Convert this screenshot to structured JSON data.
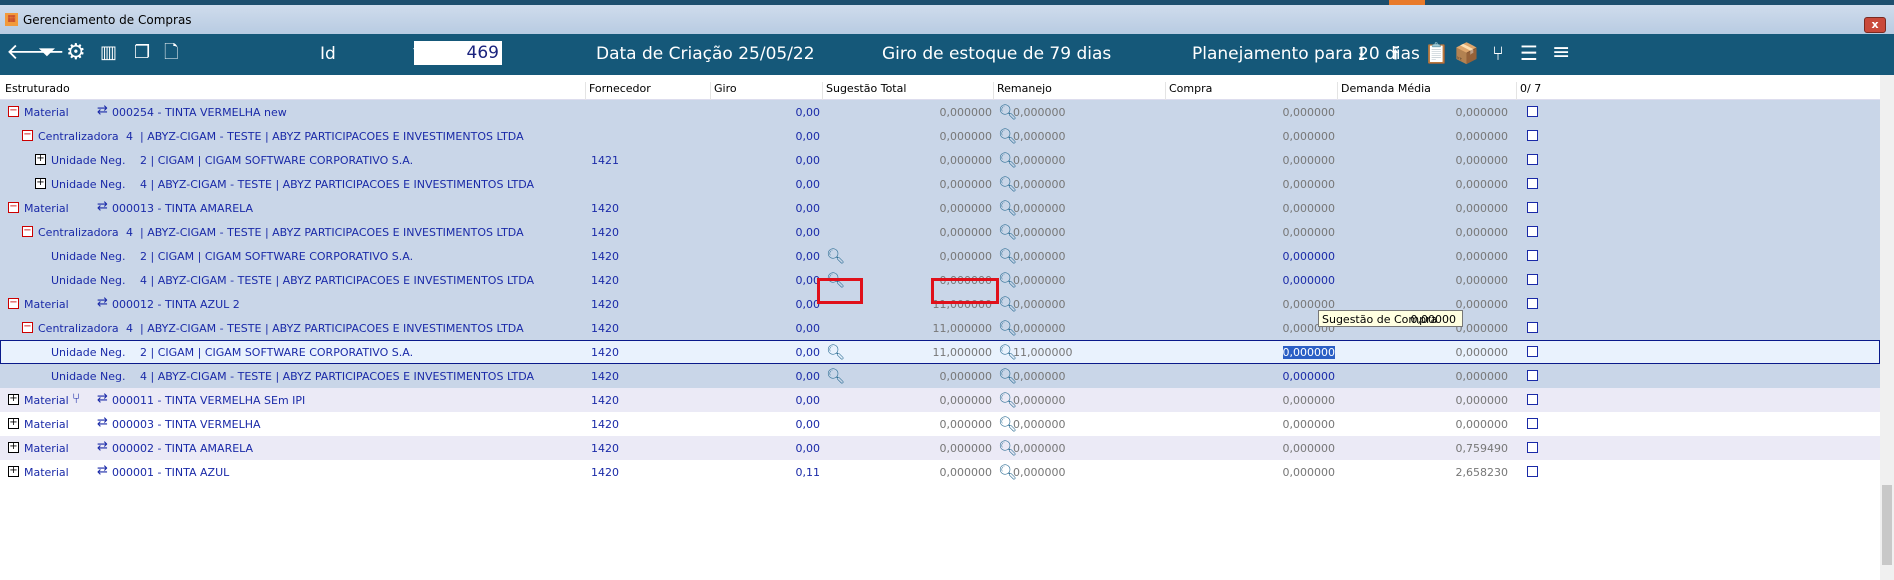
{
  "window": {
    "title": "Gerenciamento de Compras",
    "close": "x"
  },
  "toolbar": {
    "id_label": "Id",
    "id_value": "469",
    "data_criacao": "Data de Criação 25/05/22",
    "giro": "Giro de estoque de  79 dias",
    "planejamento": "Planejamento para 20 dias",
    "icons_left": [
      "arrow-left-icon",
      "filter-icon",
      "gear-icon",
      "bar-chart-icon",
      "copy-icon",
      "new-document-icon"
    ],
    "icons_right": [
      "download-icon",
      "upload-icon",
      "clipboard-icon",
      "box-icon",
      "merge-icon",
      "checklist-icon",
      "menu-icon"
    ]
  },
  "columns": [
    "Estruturado",
    "Fornecedor",
    "Giro",
    "Sugestão Total",
    "Remanejo",
    "Compra",
    "Demanda Média",
    "0/  7"
  ],
  "rows": [
    {
      "lvl": 0,
      "exp": "minus",
      "type": "Material",
      "code": "000254 - TINTA VERMELHA new",
      "forn": "",
      "giro": "0,00",
      "sug": "0,000000",
      "rem": "0,000000",
      "compra": "0,000000",
      "dem": "0,000000",
      "bg": "blue"
    },
    {
      "lvl": 1,
      "exp": "minus",
      "type": "Centralizadora",
      "num": "4",
      "code": "| ABYZ-CIGAM - TESTE | ABYZ PARTICIPACOES E INVESTIMENTOS LTDA",
      "forn": "",
      "giro": "0,00",
      "sug": "0,000000",
      "rem": "0,000000",
      "compra": "0,000000",
      "dem": "0,000000",
      "bg": "blue"
    },
    {
      "lvl": 2,
      "exp": "plus",
      "type": "Unidade Neg.",
      "code": "2 | CIGAM | CIGAM SOFTWARE CORPORATIVO S.A.",
      "forn": "1421",
      "giro": "0,00",
      "sug": "0,000000",
      "rem": "0,000000",
      "compra": "0,000000",
      "dem": "0,000000",
      "bg": "blue"
    },
    {
      "lvl": 2,
      "exp": "plus",
      "type": "Unidade Neg.",
      "code": "4 | ABYZ-CIGAM - TESTE | ABYZ PARTICIPACOES E INVESTIMENTOS LTDA",
      "forn": "",
      "giro": "0,00",
      "sug": "0,000000",
      "rem": "0,000000",
      "compra": "0,000000",
      "dem": "0,000000",
      "bg": "blue"
    },
    {
      "lvl": 0,
      "exp": "minus",
      "type": "Material",
      "code": "000013 - TINTA AMARELA",
      "forn": "1420",
      "giro": "0,00",
      "sug": "0,000000",
      "rem": "0,000000",
      "compra": "0,000000",
      "dem": "0,000000",
      "bg": "blue"
    },
    {
      "lvl": 1,
      "exp": "minus",
      "type": "Centralizadora",
      "num": "4",
      "code": "| ABYZ-CIGAM - TESTE | ABYZ PARTICIPACOES E INVESTIMENTOS LTDA",
      "forn": "1420",
      "giro": "0,00",
      "sug": "0,000000",
      "rem": "0,000000",
      "compra": "0,000000",
      "dem": "0,000000",
      "bg": "blue"
    },
    {
      "lvl": 2,
      "exp": "",
      "type": "Unidade Neg.",
      "code": "2 | CIGAM | CIGAM SOFTWARE CORPORATIVO S.A.",
      "forn": "1420",
      "giro": "0,00",
      "giromag": true,
      "sug": "0,000000",
      "rem": "0,000000",
      "compra": "0,000000",
      "compraBlue": true,
      "dem": "0,000000",
      "bg": "blue"
    },
    {
      "lvl": 2,
      "exp": "",
      "type": "Unidade Neg.",
      "code": "4 | ABYZ-CIGAM - TESTE | ABYZ PARTICIPACOES E INVESTIMENTOS LTDA",
      "forn": "1420",
      "giro": "0,00",
      "giromag": true,
      "sug": "0,000000",
      "rem": "0,000000",
      "compra": "0,000000",
      "compraBlue": true,
      "dem": "0,000000",
      "bg": "blue"
    },
    {
      "lvl": 0,
      "exp": "minus",
      "type": "Material",
      "code": "000012 - TINTA AZUL 2",
      "forn": "1420",
      "giro": "0,00",
      "sug": "11,000000",
      "rem": "0,000000",
      "compra": "0,000000",
      "dem": "0,000000",
      "bg": "blue"
    },
    {
      "lvl": 1,
      "exp": "minus",
      "type": "Centralizadora",
      "num": "4",
      "code": "| ABYZ-CIGAM - TESTE | ABYZ PARTICIPACOES E INVESTIMENTOS LTDA",
      "forn": "1420",
      "giro": "0,00",
      "sug": "11,000000",
      "rem": "0,000000",
      "compra": "0,000000",
      "dem": "0,000000",
      "bg": "blue"
    },
    {
      "lvl": 2,
      "exp": "",
      "type": "Unidade Neg.",
      "code": "2 | CIGAM | CIGAM SOFTWARE CORPORATIVO S.A.",
      "forn": "1420",
      "giro": "0,00",
      "giromag": true,
      "sug": "11,000000",
      "rem": "11,000000",
      "compra": "0,000000",
      "compraHl": true,
      "dem": "0,000000",
      "bg": "sel"
    },
    {
      "lvl": 2,
      "exp": "",
      "type": "Unidade Neg.",
      "code": "4 | ABYZ-CIGAM - TESTE | ABYZ PARTICIPACOES E INVESTIMENTOS LTDA",
      "forn": "1420",
      "giro": "0,00",
      "giromag": true,
      "sug": "0,000000",
      "rem": "0,000000",
      "compra": "0,000000",
      "compraBlue": true,
      "dem": "0,000000",
      "bg": "blue"
    },
    {
      "lvl": 0,
      "exp": "plus",
      "type": "Material",
      "merge": true,
      "code": "000011 - TINTA VERMELHA SEm IPI",
      "forn": "1420",
      "giro": "0,00",
      "sug": "0,000000",
      "rem": "0,000000",
      "compra": "0,000000",
      "dem": "0,000000",
      "bg": "lav"
    },
    {
      "lvl": 0,
      "exp": "plus",
      "type": "Material",
      "code": "000003 - TINTA VERMELHA",
      "forn": "1420",
      "giro": "0,00",
      "sug": "0,000000",
      "rem": "0,000000",
      "compra": "0,000000",
      "dem": "0,000000",
      "bg": "white"
    },
    {
      "lvl": 0,
      "exp": "plus",
      "type": "Material",
      "code": "000002 - TINTA AMARELA",
      "forn": "1420",
      "giro": "0,00",
      "sug": "0,000000",
      "rem": "0,000000",
      "compra": "0,000000",
      "dem": "0,759490",
      "bg": "lav"
    },
    {
      "lvl": 0,
      "exp": "plus",
      "type": "Material",
      "code": "000001 - TINTA AZUL",
      "forn": "1420",
      "giro": "0,11",
      "sug": "0,000000",
      "rem": "0,000000",
      "compra": "0,000000",
      "dem": "2,658230",
      "bg": "white"
    }
  ],
  "tooltip": {
    "label": "Sugestão de Compra",
    "value": "0,00000"
  },
  "colors": {
    "toolbar": "#155879",
    "group_row": "#c9d6e8",
    "alt_row": "#ebeaf6",
    "text": "#1a2aa8",
    "highlight": "#e0101a"
  }
}
